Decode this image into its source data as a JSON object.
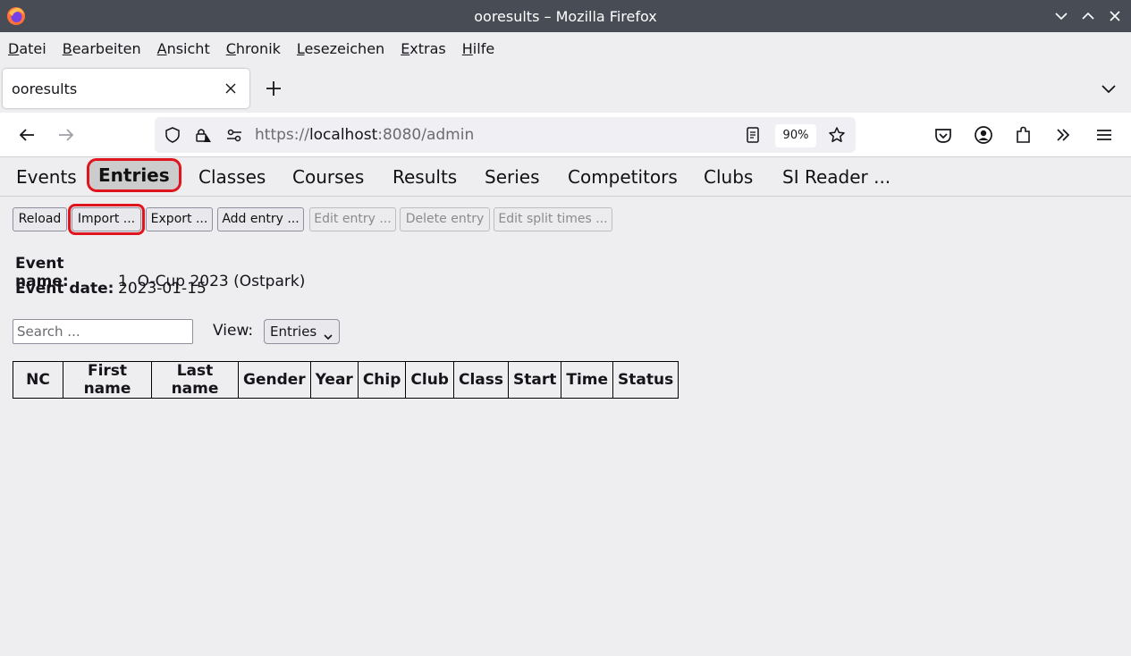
{
  "window": {
    "title": "ooresults – Mozilla Firefox"
  },
  "menu": [
    {
      "accel": "D",
      "rest": "atei"
    },
    {
      "accel": "B",
      "rest": "earbeiten"
    },
    {
      "accel": "A",
      "rest": "nsicht"
    },
    {
      "accel": "C",
      "rest": "hronik"
    },
    {
      "accel": "L",
      "rest": "esezeichen"
    },
    {
      "accel": "E",
      "rest": "xtras"
    },
    {
      "accel": "H",
      "rest": "ilfe"
    }
  ],
  "tab": {
    "title": "ooresults"
  },
  "urlbar": {
    "scheme": "https://",
    "host": "localhost",
    "rest": ":8080/admin",
    "zoom": "90%"
  },
  "nav_tabs": [
    "Events",
    "Entries",
    "Classes",
    "Courses",
    "Results",
    "Series",
    "Competitors",
    "Clubs",
    "SI Reader ..."
  ],
  "active_tab": "Entries",
  "toolbar": {
    "reload": "Reload",
    "import": "Import ...",
    "export": "Export ...",
    "add_entry": "Add entry ...",
    "edit_entry": "Edit entry ...",
    "delete_entry": "Delete entry",
    "edit_split_times": "Edit split times ..."
  },
  "event": {
    "name_label": "Event name:",
    "name": "1. O-Cup 2023 (Ostpark)",
    "date_label": "Event date:",
    "date": "2023-01-15"
  },
  "search": {
    "placeholder": "Search ..."
  },
  "view": {
    "label": "View:",
    "selected": "Entries"
  },
  "table": {
    "columns": [
      "NC",
      "First name",
      "Last name",
      "Gender",
      "Year",
      "Chip",
      "Club",
      "Class",
      "Start",
      "Time",
      "Status"
    ],
    "rows": []
  },
  "colors": {
    "highlight": "#e0141e",
    "titlebar": "#474c55"
  }
}
